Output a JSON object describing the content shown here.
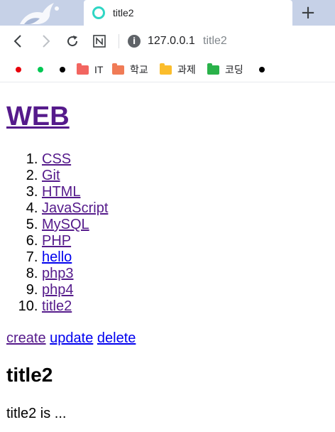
{
  "browser": {
    "active_tab": {
      "title": "title2"
    },
    "new_tab_label": "+",
    "address": {
      "info": "i",
      "host": "127.0.0.1",
      "path": "title2"
    },
    "bookmarks": [
      {
        "type": "dot",
        "color": "#e8000b",
        "label": ""
      },
      {
        "type": "dot",
        "color": "#00c853",
        "label": ""
      },
      {
        "type": "dot",
        "color": "#000000",
        "label": ""
      },
      {
        "type": "folder",
        "color": "#f26560",
        "label": "IT"
      },
      {
        "type": "folder",
        "color": "#f07b56",
        "label": "학교"
      },
      {
        "type": "folder",
        "color": "#fbbd2c",
        "label": "과제"
      },
      {
        "type": "folder",
        "color": "#2ab24a",
        "label": "코딩"
      },
      {
        "type": "dot",
        "color": "#000000",
        "label": ""
      }
    ]
  },
  "page": {
    "site_title": "WEB",
    "nav": [
      {
        "label": "CSS",
        "visited": true
      },
      {
        "label": "Git",
        "visited": true
      },
      {
        "label": "HTML",
        "visited": true
      },
      {
        "label": "JavaScript",
        "visited": true
      },
      {
        "label": "MySQL",
        "visited": true
      },
      {
        "label": "PHP",
        "visited": true
      },
      {
        "label": "hello",
        "visited": false
      },
      {
        "label": "php3",
        "visited": true
      },
      {
        "label": "php4",
        "visited": true
      },
      {
        "label": "title2",
        "visited": true
      }
    ],
    "controls": {
      "create": "create",
      "update": "update",
      "delete": "delete"
    },
    "doc_title": "title2",
    "doc_body": "title2 is ..."
  }
}
